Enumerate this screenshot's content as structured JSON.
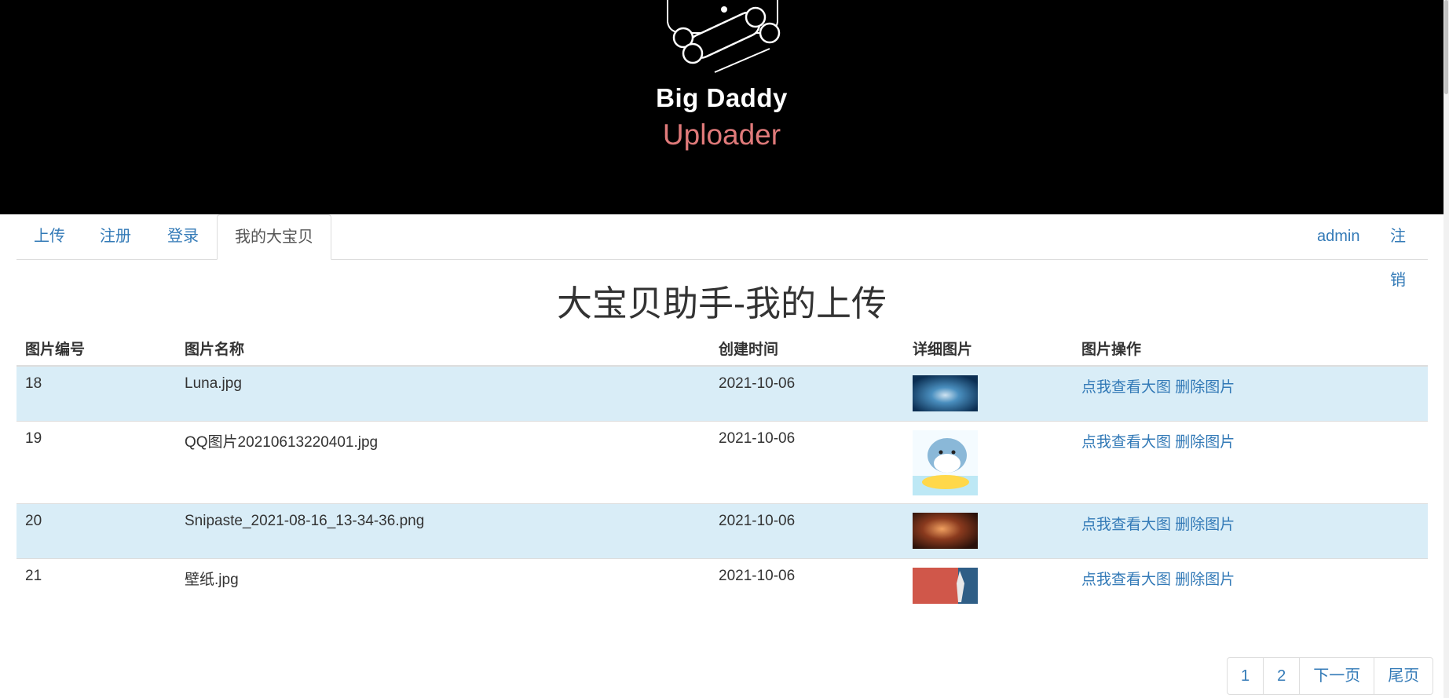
{
  "header": {
    "brand_line1": "Big Daddy",
    "brand_line2": "Uploader"
  },
  "nav": {
    "left": [
      "上传",
      "注册",
      "登录",
      "我的大宝贝"
    ],
    "active": "我的大宝贝",
    "user": "admin",
    "logout": "注销"
  },
  "page_title": "大宝贝助手-我的上传",
  "table": {
    "headers": [
      "图片编号",
      "图片名称",
      "创建时间",
      "详细图片",
      "图片操作"
    ],
    "rows": [
      {
        "id": "18",
        "name": "Luna.jpg",
        "created": "2021-10-06",
        "view": "点我查看大图",
        "delete": "删除图片"
      },
      {
        "id": "19",
        "name": "QQ图片20210613220401.jpg",
        "created": "2021-10-06",
        "view": "点我查看大图",
        "delete": "删除图片"
      },
      {
        "id": "20",
        "name": "Snipaste_2021-08-16_13-34-36.png",
        "created": "2021-10-06",
        "view": "点我查看大图",
        "delete": "删除图片"
      },
      {
        "id": "21",
        "name": "壁纸.jpg",
        "created": "2021-10-06",
        "view": "点我查看大图",
        "delete": "删除图片"
      }
    ]
  },
  "pagination": [
    "1",
    "2",
    "下一页",
    "尾页"
  ],
  "colors": {
    "link": "#337ab7",
    "row_highlight": "#d9edf7",
    "brand_accent": "#e07a7a",
    "hero_bg": "#000000"
  }
}
